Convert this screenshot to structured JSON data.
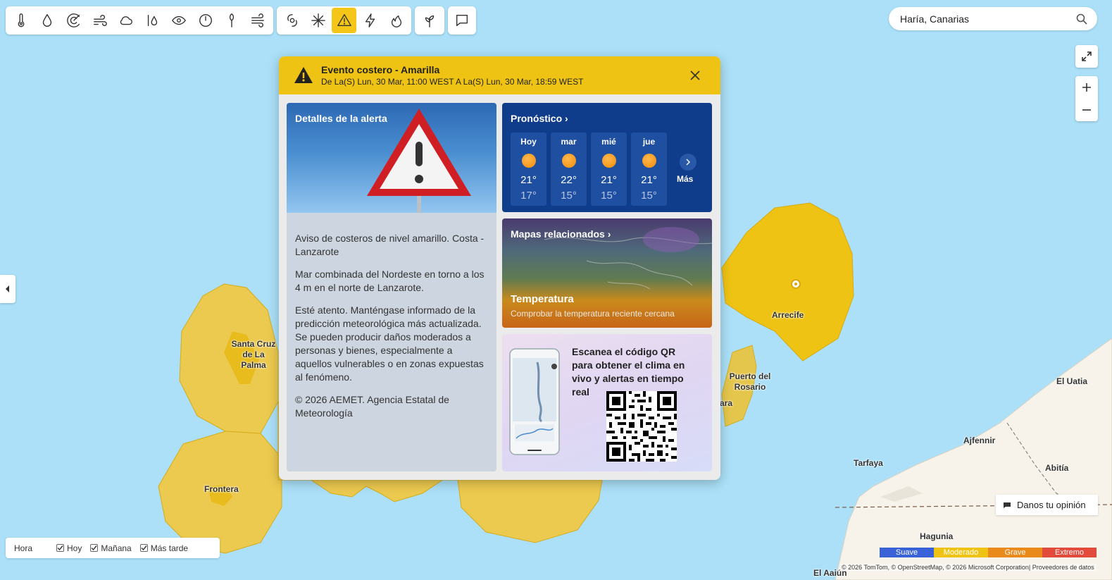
{
  "toolbar": {
    "group1": [
      "thermometer-icon",
      "precipitation-icon",
      "radar-icon",
      "wind-icon",
      "cloud-icon",
      "humidity-icon",
      "visibility-icon",
      "pressure-icon",
      "pollen-icon",
      "air-quality-icon"
    ],
    "group2": [
      "hurricane-icon",
      "winter-icon",
      "alert-icon",
      "lightning-icon",
      "wildfire-icon"
    ],
    "group3": [
      "plant-icon"
    ],
    "group4": [
      "comment-icon"
    ],
    "active": "alert-icon"
  },
  "search": {
    "value": "Haría, Canarias"
  },
  "alert": {
    "title": "Evento costero - Amarilla",
    "period": "De La(S) Lun, 30 Mar, 11:00 WEST A La(S) Lun, 30 Mar, 18:59 WEST",
    "details_title": "Detalles de la alerta",
    "paragraphs": [
      "Aviso de costeros de nivel amarillo. Costa - Lanzarote",
      "Mar combinada del Nordeste en torno a los 4 m en el norte de Lanzarote.",
      "Esté atento. Manténgase informado de la predicción meteorológica más actualizada. Se pueden producir daños moderados a personas y bienes, especialmente a aquellos vulnerables o en zonas expuestas al fenómeno.",
      "© 2026 AEMET. Agencia Estatal de Meteorología"
    ]
  },
  "forecast": {
    "title": "Pronóstico",
    "more_label": "Más",
    "days": [
      {
        "name": "Hoy",
        "high": "21°",
        "low": "17°"
      },
      {
        "name": "mar",
        "high": "22°",
        "low": "15°"
      },
      {
        "name": "mié",
        "high": "21°",
        "low": "15°"
      },
      {
        "name": "jue",
        "high": "21°",
        "low": "15°"
      }
    ]
  },
  "maps": {
    "title": "Mapas relacionados",
    "card_title": "Temperatura",
    "card_sub": "Comprobar la temperatura reciente cercana"
  },
  "qr": {
    "text": "Escanea el código QR para obtener el clima en vivo y alertas en tiempo real"
  },
  "map_labels": {
    "arrecife": "Arrecife",
    "santa_cruz": "Santa Cruz de La Palma",
    "frontera": "Frontera",
    "puerto_rosario": "Puerto del Rosario",
    "ara": "ara",
    "el_uatia": "El Uatia",
    "ajfennir": "Ajfennir",
    "tarfaya": "Tarfaya",
    "abitia": "Abitía",
    "hagunia": "Hagunia",
    "el_aaiun": "El Aaiún"
  },
  "time_legend": {
    "label": "Hora",
    "options": [
      {
        "label": "Hoy",
        "checked": true
      },
      {
        "label": "Mañana",
        "checked": true
      },
      {
        "label": "Más tarde",
        "checked": true
      }
    ]
  },
  "feedback": {
    "label": "Danos tu opinión"
  },
  "severity": [
    {
      "label": "Suave",
      "color": "#3a62d8"
    },
    {
      "label": "Moderado",
      "color": "#efc313"
    },
    {
      "label": "Grave",
      "color": "#e98a1a"
    },
    {
      "label": "Extremo",
      "color": "#e24b3b"
    }
  ],
  "attribution": "© 2026 TomTom,   © OpenStreetMap, © 2026 Microsoft Corporation|  Proveedores de datos"
}
